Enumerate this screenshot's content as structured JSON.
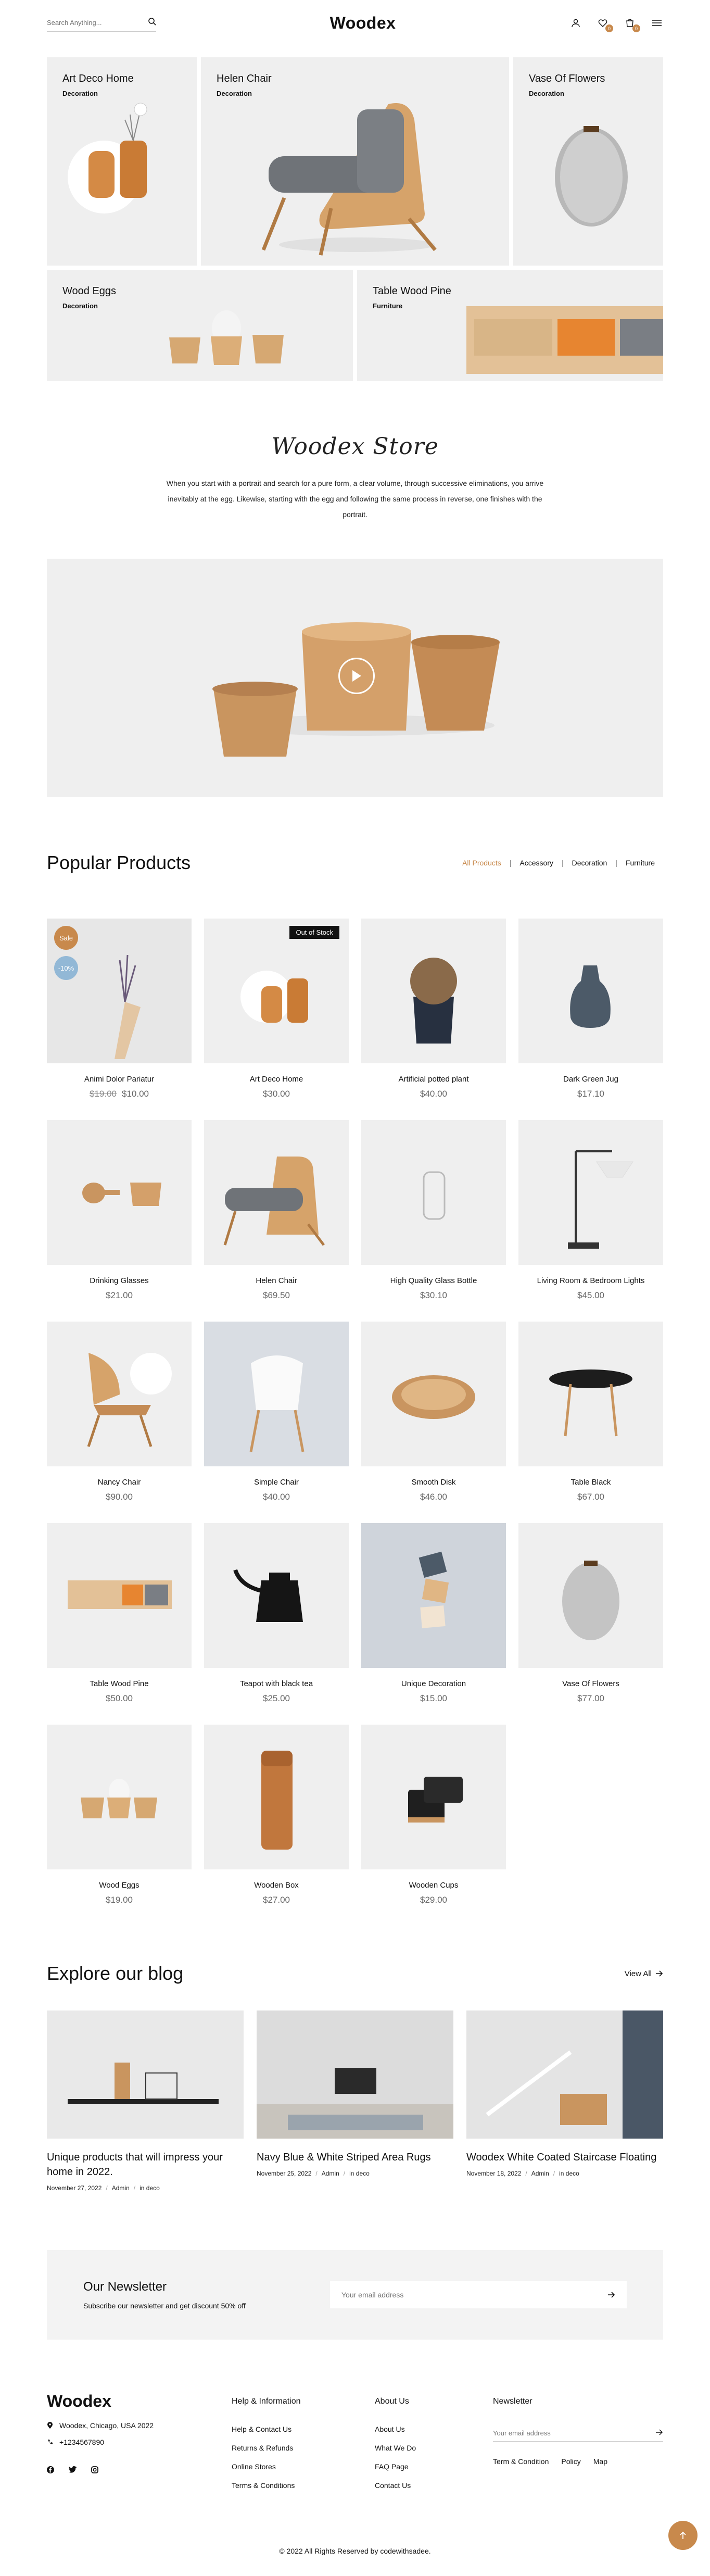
{
  "header": {
    "search_placeholder": "Search Anything...",
    "logo": "Woodex",
    "wishlist_count": "0",
    "cart_count": "0"
  },
  "hero": [
    {
      "title": "Art Deco Home",
      "category": "Decoration"
    },
    {
      "title": "Helen Chair",
      "category": "Decoration"
    },
    {
      "title": "Vase Of Flowers",
      "category": "Decoration"
    },
    {
      "title": "Wood Eggs",
      "category": "Decoration"
    },
    {
      "title": "Table Wood Pine",
      "category": "Furniture"
    }
  ],
  "store": {
    "title": "Woodex Store",
    "text": "When you start with a portrait and search for a pure form, a clear volume, through successive eliminations, you arrive inevitably at the egg. Likewise, starting with the egg and following the same process in reverse, one finishes with the portrait."
  },
  "popular": {
    "title": "Popular Products",
    "filters": [
      "All Products",
      "Accessory",
      "Decoration",
      "Furniture"
    ],
    "products": [
      {
        "name": "Animi Dolor Pariatur",
        "old_price": "$19.00",
        "price": "$10.00",
        "sale": "Sale",
        "discount": "-10%"
      },
      {
        "name": "Art Deco Home",
        "price": "$30.00",
        "stock": "Out of Stock"
      },
      {
        "name": "Artificial potted plant",
        "price": "$40.00"
      },
      {
        "name": "Dark Green Jug",
        "price": "$17.10"
      },
      {
        "name": "Drinking Glasses",
        "price": "$21.00"
      },
      {
        "name": "Helen Chair",
        "price": "$69.50"
      },
      {
        "name": "High Quality Glass Bottle",
        "price": "$30.10"
      },
      {
        "name": "Living Room & Bedroom Lights",
        "price": "$45.00"
      },
      {
        "name": "Nancy Chair",
        "price": "$90.00"
      },
      {
        "name": "Simple Chair",
        "price": "$40.00"
      },
      {
        "name": "Smooth Disk",
        "price": "$46.00"
      },
      {
        "name": "Table Black",
        "price": "$67.00"
      },
      {
        "name": "Table Wood Pine",
        "price": "$50.00"
      },
      {
        "name": "Teapot with black tea",
        "price": "$25.00"
      },
      {
        "name": "Unique Decoration",
        "price": "$15.00"
      },
      {
        "name": "Vase Of Flowers",
        "price": "$77.00"
      },
      {
        "name": "Wood Eggs",
        "price": "$19.00"
      },
      {
        "name": "Wooden Box",
        "price": "$27.00"
      },
      {
        "name": "Wooden Cups",
        "price": "$29.00"
      }
    ]
  },
  "blog": {
    "title": "Explore our blog",
    "view_all": "View All",
    "posts": [
      {
        "title": "Unique products that will impress your home in 2022.",
        "date": "November 27, 2022",
        "author": "Admin",
        "category": "in deco"
      },
      {
        "title": "Navy Blue & White Striped Area Rugs",
        "date": "November 25, 2022",
        "author": "Admin",
        "category": "in deco"
      },
      {
        "title": "Woodex White Coated Staircase Floating",
        "date": "November 18, 2022",
        "author": "Admin",
        "category": "in deco"
      }
    ]
  },
  "newsletter": {
    "title": "Our Newsletter",
    "text": "Subscribe our newsletter and get discount 50% off",
    "placeholder": "Your email address"
  },
  "footer": {
    "logo": "Woodex",
    "address": "Woodex, Chicago, USA 2022",
    "phone": "+1234567890",
    "col1_title": "Help & Information",
    "col1_links": [
      "Help & Contact Us",
      "Returns & Refunds",
      "Online Stores",
      "Terms & Conditions"
    ],
    "col2_title": "About Us",
    "col2_links": [
      "About Us",
      "What We Do",
      "FAQ Page",
      "Contact Us"
    ],
    "col3_title": "Newsletter",
    "col3_placeholder": "Your email address",
    "col3_links": [
      "Term & Condition",
      "Policy",
      "Map"
    ],
    "copyright": "© 2022 All Rights Reserved by codewithsadee."
  },
  "colors": {
    "accent": "#c8894c",
    "tile": "#efefef"
  }
}
